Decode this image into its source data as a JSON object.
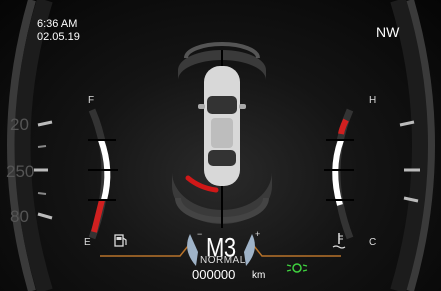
{
  "status": {
    "time": "6:36 AM",
    "date": "02.05.19",
    "heading": "NW"
  },
  "speedometer": {
    "ticks": [
      "20",
      "250",
      "80"
    ]
  },
  "fuel_gauge": {
    "full_label": "F",
    "empty_label": "E",
    "icon": "fuel-pump-icon"
  },
  "temp_gauge": {
    "hot_label": "H",
    "cold_label": "C",
    "icon": "coolant-temperature-icon"
  },
  "transmission": {
    "gear": "M3",
    "mode": "NORMAL",
    "downshift_label": "−",
    "upshift_label": "+"
  },
  "odometer": {
    "value": "000000",
    "unit": "km"
  },
  "indicators": {
    "lights_icon": "parking-lights-icon",
    "lights_color": "#3fd23f"
  },
  "parking_sensor": {
    "alert_zone": "rear-left",
    "alert_color": "#d01818"
  },
  "colors": {
    "accent_orange": "#b8732a",
    "gauge_red": "#d02020"
  }
}
